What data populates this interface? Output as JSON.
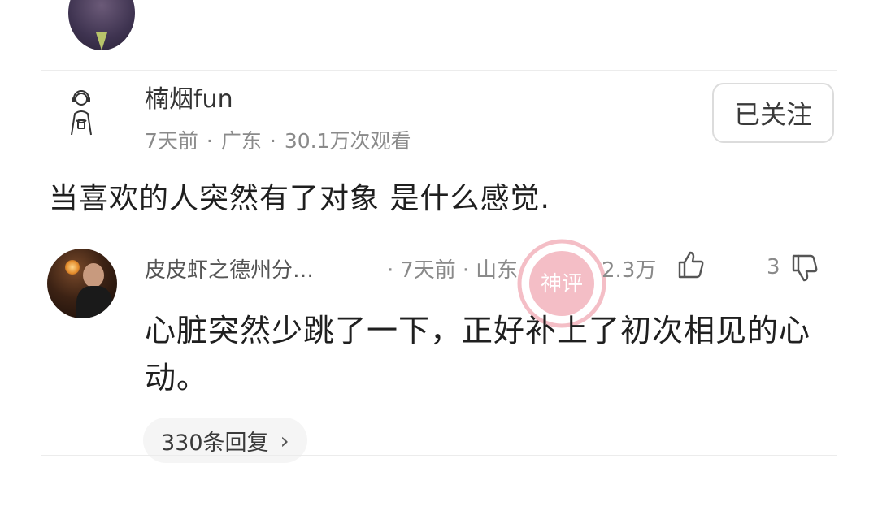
{
  "post": {
    "author_name": "楠烟fun",
    "time": "7天前",
    "location": "广东",
    "views": "30.1万次观看",
    "follow_label": "已关注",
    "title": "当喜欢的人突然有了对象 是什么感觉."
  },
  "comment": {
    "username": "皮皮虾之德州分…",
    "time": "7天前",
    "location": "山东",
    "likes": "2.3万",
    "dislikes": "3",
    "text": "心脏突然少跳了一下，正好补上了初次相见的心动。",
    "replies_label": "330条回复",
    "chevron": "›"
  },
  "separator": "·",
  "watermark_text": "神评",
  "colors": {
    "text_primary": "#1f1f1f",
    "text_secondary": "#8a8a8a",
    "watermark": "#e0485f"
  }
}
